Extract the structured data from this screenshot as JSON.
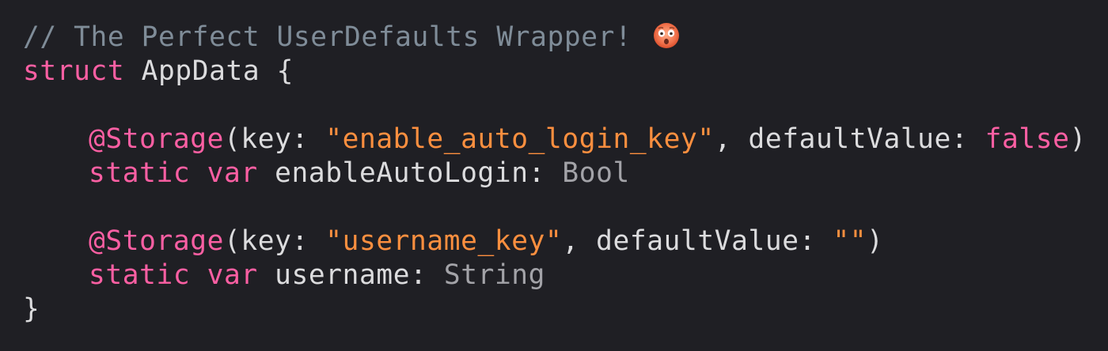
{
  "code": {
    "line1": {
      "comment": "// The Perfect UserDefaults Wrapper!",
      "emoji": "astonished-face-icon"
    },
    "line2": {
      "kw_struct": "struct",
      "name": " AppData {"
    },
    "line4": {
      "attr": "@Storage",
      "open": "(key: ",
      "key": "\"enable_auto_login_key\"",
      "mid": ", defaultValue: ",
      "value": "false",
      "close": ")"
    },
    "line5": {
      "kw_static": "static",
      "kw_var": "var",
      "name": " enableAutoLogin: ",
      "type": "Bool"
    },
    "line7": {
      "attr": "@Storage",
      "open": "(key: ",
      "key": "\"username_key\"",
      "mid": ", defaultValue: ",
      "value": "\"\"",
      "close": ")"
    },
    "line8": {
      "kw_static": "static",
      "kw_var": "var",
      "name": " username: ",
      "type": "String"
    },
    "line9": {
      "brace": "}"
    }
  },
  "colors": {
    "background": "#1f1f24",
    "comment": "#7f8c98",
    "keyword": "#fc5fa3",
    "string": "#fd8f3f",
    "type": "#a3a3a8",
    "plain": "#dcdcde"
  }
}
